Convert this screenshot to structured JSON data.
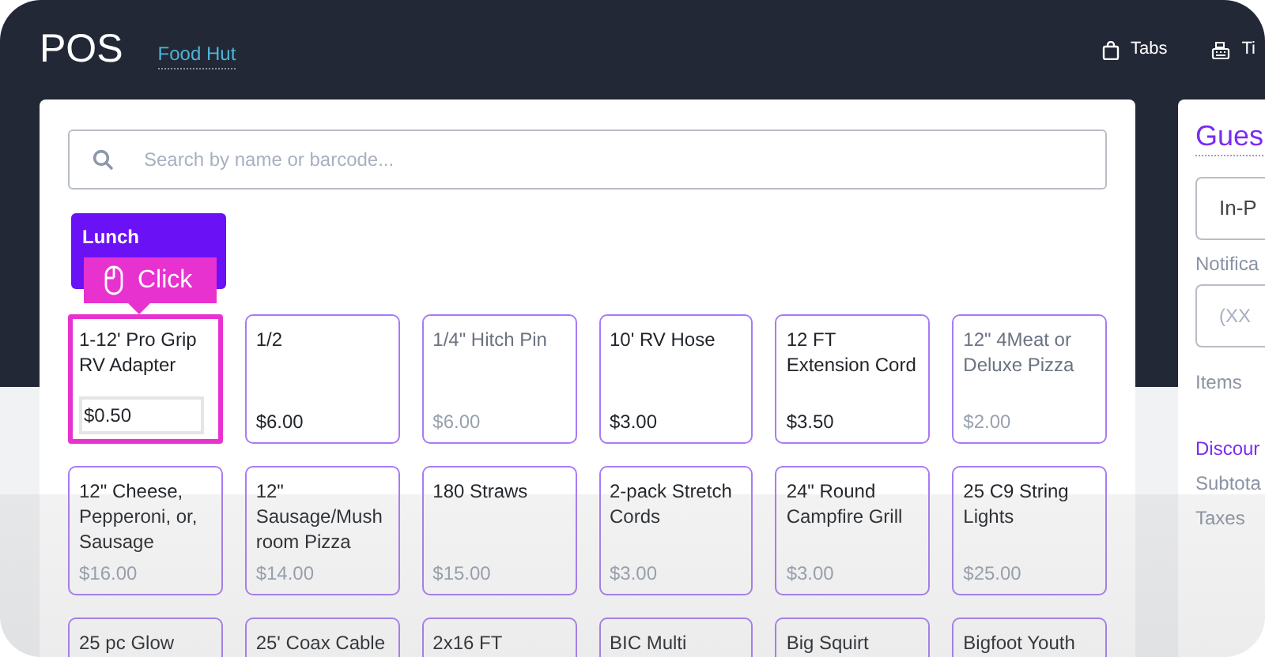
{
  "header": {
    "title": "POS",
    "location": "Food Hut",
    "nav": [
      {
        "kind": "bag",
        "label": "Tabs"
      },
      {
        "kind": "register",
        "label": "Ti"
      }
    ]
  },
  "search": {
    "placeholder": "Search by name or barcode..."
  },
  "categories": [
    {
      "label": "Lunch",
      "selected": true
    }
  ],
  "tooltip": {
    "label": "Click"
  },
  "products": [
    {
      "name": "1-12' Pro Grip RV Adapter",
      "price": "$0.50",
      "name_muted": false,
      "price_muted": false,
      "highlighted": true
    },
    {
      "name": "1/2",
      "price": "$6.00",
      "name_muted": false,
      "price_muted": false,
      "highlighted": false
    },
    {
      "name": "1/4\" Hitch Pin",
      "price": "$6.00",
      "name_muted": true,
      "price_muted": true,
      "highlighted": false
    },
    {
      "name": "10' RV Hose",
      "price": "$3.00",
      "name_muted": false,
      "price_muted": false,
      "highlighted": false
    },
    {
      "name": "12 FT Extension Cord",
      "price": "$3.50",
      "name_muted": false,
      "price_muted": false,
      "highlighted": false
    },
    {
      "name": "12\" 4Meat or Deluxe Pizza",
      "price": "$2.00",
      "name_muted": true,
      "price_muted": true,
      "highlighted": false
    },
    {
      "name": "12\" Cheese, Pepperoni, or, Sausage",
      "price": "$16.00",
      "name_muted": false,
      "price_muted": true,
      "highlighted": false
    },
    {
      "name": "12\" Sausage/Mushroom Pizza",
      "price": "$14.00",
      "name_muted": false,
      "price_muted": true,
      "highlighted": false
    },
    {
      "name": "180 Straws",
      "price": "$15.00",
      "name_muted": false,
      "price_muted": true,
      "highlighted": false
    },
    {
      "name": "2-pack Stretch Cords",
      "price": "$3.00",
      "name_muted": false,
      "price_muted": true,
      "highlighted": false
    },
    {
      "name": "24\" Round Campfire Grill",
      "price": "$3.00",
      "name_muted": false,
      "price_muted": true,
      "highlighted": false
    },
    {
      "name": "25 C9 String Lights",
      "price": "$25.00",
      "name_muted": false,
      "price_muted": true,
      "highlighted": false
    },
    {
      "name": "25 pc Glow",
      "name_muted": false,
      "highlighted": false
    },
    {
      "name": "25' Coax Cable",
      "name_muted": false,
      "highlighted": false
    },
    {
      "name": "2x16 FT",
      "name_muted": false,
      "highlighted": false
    },
    {
      "name": "BIC Multi",
      "name_muted": false,
      "highlighted": false
    },
    {
      "name": "Big Squirt",
      "name_muted": false,
      "highlighted": false
    },
    {
      "name": "Bigfoot Youth",
      "name_muted": false,
      "highlighted": false
    }
  ],
  "order_panel": {
    "title": "Gues",
    "order_type": "In-P",
    "notification_label": "Notifica",
    "phone_placeholder": "(XX",
    "items_label": "Items",
    "discount_link": "Discour",
    "subtotal_label": "Subtota",
    "taxes_label": "Taxes"
  }
}
